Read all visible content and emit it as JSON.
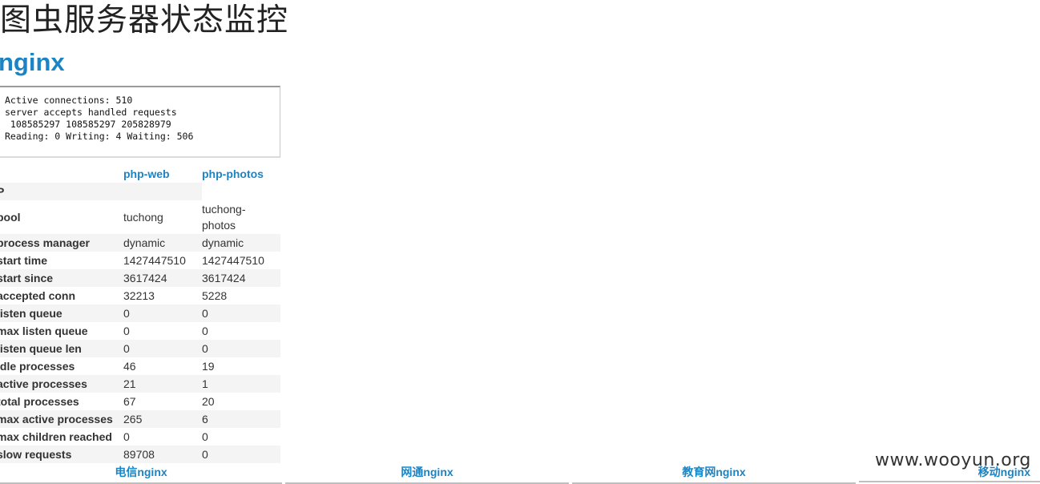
{
  "page": {
    "title": "图虫服务器状态监控"
  },
  "nginx": {
    "title": "nginx",
    "status_text": "Active connections: 510 \nserver accepts handled requests\n 108585297 108585297 205828979 \nReading: 0 Writing: 4 Waiting: 506 "
  },
  "php": {
    "columns": [
      "php-web",
      "php-photos"
    ],
    "rows": [
      {
        "label": "P",
        "web": "",
        "photos": ""
      },
      {
        "label": "pool",
        "web": "tuchong",
        "photos": "tuchong-\nphotos"
      },
      {
        "label": "process manager",
        "web": "dynamic",
        "photos": "dynamic"
      },
      {
        "label": "start time",
        "web": "1427447510",
        "photos": "1427447510"
      },
      {
        "label": "start since",
        "web": "3617424",
        "photos": "3617424"
      },
      {
        "label": "accepted conn",
        "web": "32213",
        "photos": "5228"
      },
      {
        "label": "listen queue",
        "web": "0",
        "photos": "0"
      },
      {
        "label": "max listen queue",
        "web": "0",
        "photos": "0"
      },
      {
        "label": "listen queue len",
        "web": "0",
        "photos": "0"
      },
      {
        "label": "idle processes",
        "web": "46",
        "photos": "19"
      },
      {
        "label": "active processes",
        "web": "21",
        "photos": "1"
      },
      {
        "label": "total processes",
        "web": "67",
        "photos": "20"
      },
      {
        "label": "max active processes",
        "web": "265",
        "photos": "6"
      },
      {
        "label": "max children reached",
        "web": "0",
        "photos": "0"
      },
      {
        "label": "slow requests",
        "web": "89708",
        "photos": "0"
      }
    ]
  },
  "footer": {
    "links": [
      "电信nginx",
      "网通nginx",
      "教育网nginx",
      "移动nginx"
    ]
  },
  "watermark": "www.wooyun.org",
  "colors": {
    "link": "#1b84c4",
    "row_alt": "#f4f4f4"
  }
}
